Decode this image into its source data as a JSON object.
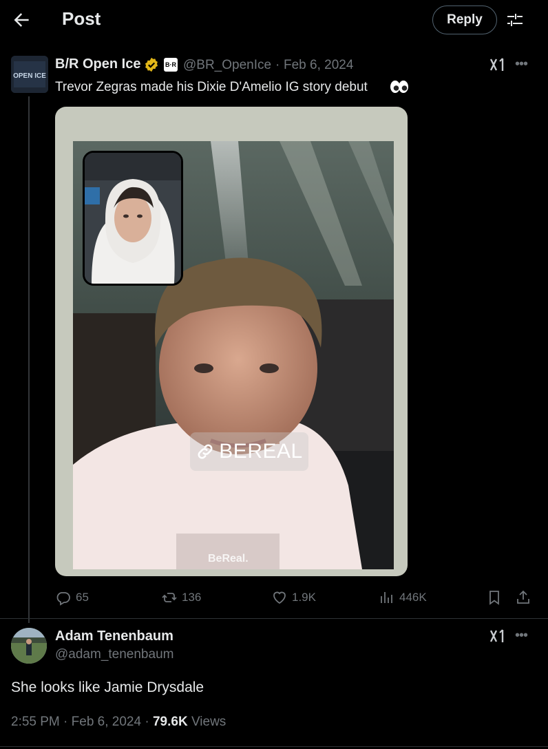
{
  "header": {
    "title": "Post",
    "reply_label": "Reply",
    "icons": [
      "back-arrow-icon",
      "filter-sliders-icon"
    ]
  },
  "post": {
    "author_name": "B/R Open Ice",
    "avatar_text": "OPEN ICE",
    "affiliate_badge": "B·R",
    "handle": "@BR_OpenIce",
    "separator": "·",
    "date": "Feb 6, 2024",
    "text": "Trevor Zegras made his Dixie D'Amelio IG story debut",
    "emoji": "eyes-emoji",
    "media": {
      "chip_text": "BEREAL",
      "watermark": "BeReal."
    },
    "stats": {
      "replies": "65",
      "reposts": "136",
      "likes": "1.9K",
      "views": "446K"
    }
  },
  "reply": {
    "author_name": "Adam Tenenbaum",
    "handle": "@adam_tenenbaum",
    "text": "She looks like Jamie Drysdale",
    "time": "2:55 PM",
    "date": "Feb 6, 2024",
    "views_count": "79.6K",
    "views_label": "Views",
    "sep": "·"
  },
  "colors": {
    "background": "#000000",
    "text": "#e7e9ea",
    "muted": "#71767b",
    "verified_gold": "#e2b719"
  }
}
